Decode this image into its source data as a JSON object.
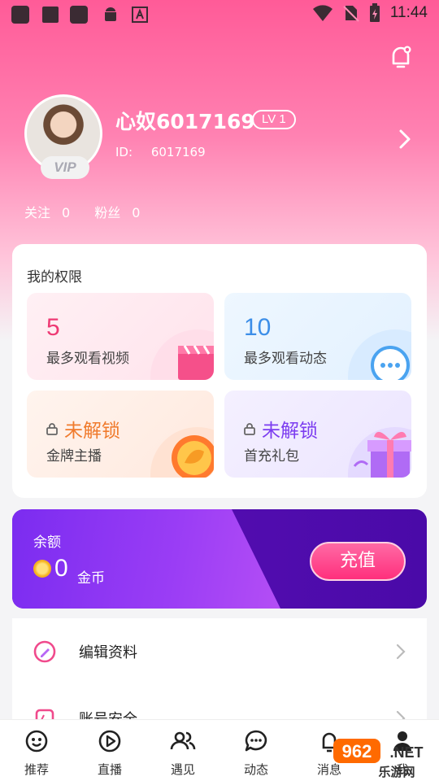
{
  "status_bar": {
    "time": "11:44"
  },
  "profile": {
    "username": "心奴6017169",
    "level": "LV 1",
    "id_label": "ID:",
    "id_value": "6017169",
    "vip_badge": "VIP",
    "follow_label": "关注",
    "follow_count": "0",
    "fans_label": "粉丝",
    "fans_count": "0"
  },
  "permissions": {
    "title": "我的权限",
    "tiles": [
      {
        "value": "5",
        "label": "最多观看视频",
        "icon": "clapperboard-icon"
      },
      {
        "value": "10",
        "label": "最多观看动态",
        "icon": "chat-bubble-icon"
      },
      {
        "value": "未解锁",
        "label": "金牌主播",
        "icon": "gold-medal-icon"
      },
      {
        "value": "未解锁",
        "label": "首充礼包",
        "icon": "gift-box-icon"
      }
    ]
  },
  "balance": {
    "label": "余额",
    "amount": "0",
    "unit": "金币",
    "recharge_label": "充值"
  },
  "menu": [
    {
      "label": "编辑资料",
      "icon": "edit-icon"
    },
    {
      "label": "账号安全",
      "icon": "shield-icon"
    }
  ],
  "tabs": [
    {
      "label": "推荐",
      "icon": "smile-icon"
    },
    {
      "label": "直播",
      "icon": "play-icon"
    },
    {
      "label": "遇见",
      "icon": "people-icon"
    },
    {
      "label": "动态",
      "icon": "chat-icon"
    },
    {
      "label": "消息",
      "icon": "bell-icon"
    },
    {
      "label": "我",
      "icon": "person-icon"
    }
  ],
  "watermark": {
    "top": "962",
    "bottom": "乐游网",
    "suffix": ".NET"
  },
  "colors": {
    "brand_pink": "#ff5b98",
    "balance_purple": "#5a0fb7",
    "recharge_pink": "#ff2f7c"
  }
}
